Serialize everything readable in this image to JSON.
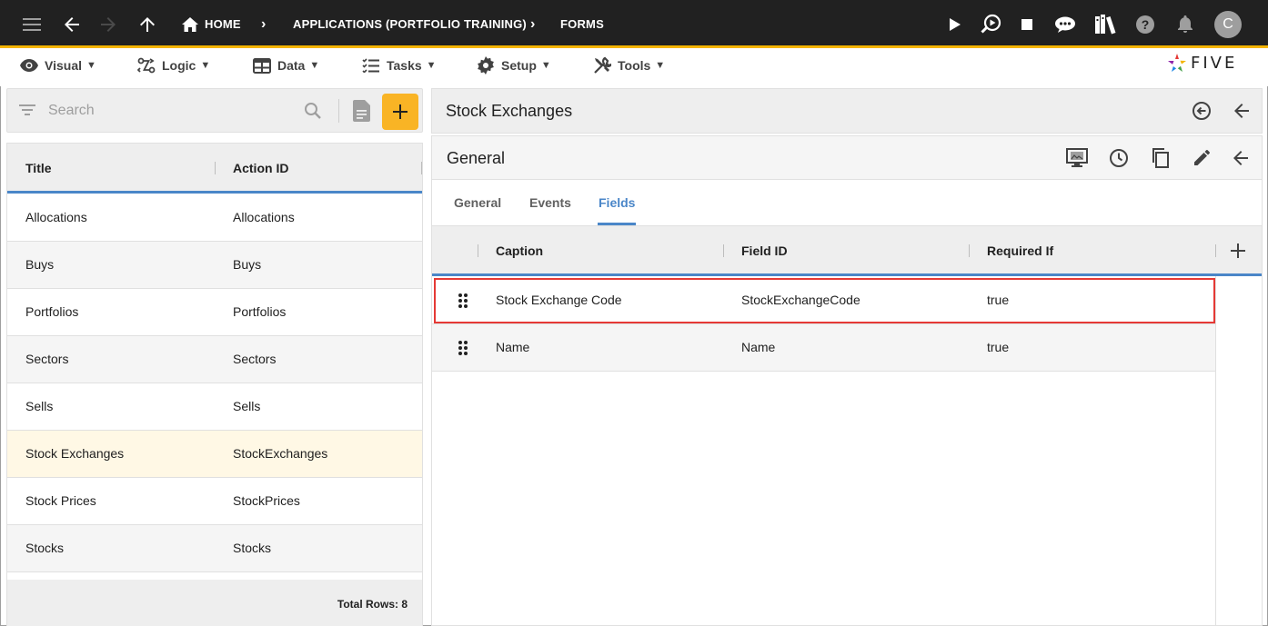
{
  "topbar": {
    "breadcrumb": [
      {
        "label": "HOME"
      },
      {
        "label": "APPLICATIONS (PORTFOLIO TRAINING)"
      },
      {
        "label": "FORMS"
      }
    ],
    "avatar_letter": "C",
    "accent_color": "#f4b400"
  },
  "menubar": {
    "items": [
      {
        "label": "Visual",
        "icon": "eye-icon"
      },
      {
        "label": "Logic",
        "icon": "logic-icon"
      },
      {
        "label": "Data",
        "icon": "table-icon"
      },
      {
        "label": "Tasks",
        "icon": "tasks-icon"
      },
      {
        "label": "Setup",
        "icon": "gear-icon"
      },
      {
        "label": "Tools",
        "icon": "tools-icon"
      }
    ],
    "logo_text": "FIVE"
  },
  "list": {
    "search_placeholder": "Search",
    "columns": [
      "Title",
      "Action ID"
    ],
    "rows": [
      {
        "title": "Allocations",
        "action_id": "Allocations"
      },
      {
        "title": "Buys",
        "action_id": "Buys"
      },
      {
        "title": "Portfolios",
        "action_id": "Portfolios"
      },
      {
        "title": "Sectors",
        "action_id": "Sectors"
      },
      {
        "title": "Sells",
        "action_id": "Sells"
      },
      {
        "title": "Stock Exchanges",
        "action_id": "StockExchanges"
      },
      {
        "title": "Stock Prices",
        "action_id": "StockPrices"
      },
      {
        "title": "Stocks",
        "action_id": "Stocks"
      }
    ],
    "selected_index": 5,
    "footer": "Total Rows: 8"
  },
  "form": {
    "title": "Stock Exchanges",
    "section_title": "General",
    "tabs": [
      {
        "label": "General"
      },
      {
        "label": "Events"
      },
      {
        "label": "Fields"
      }
    ],
    "active_tab": "Fields",
    "grid_columns": [
      "Caption",
      "Field ID",
      "Required If"
    ],
    "grid_rows": [
      {
        "caption": "Stock Exchange Code",
        "field_id": "StockExchangeCode",
        "required_if": "true"
      },
      {
        "caption": "Name",
        "field_id": "Name",
        "required_if": "true"
      }
    ],
    "highlight_color": "#e53935",
    "active_color": "#4a86c8"
  }
}
